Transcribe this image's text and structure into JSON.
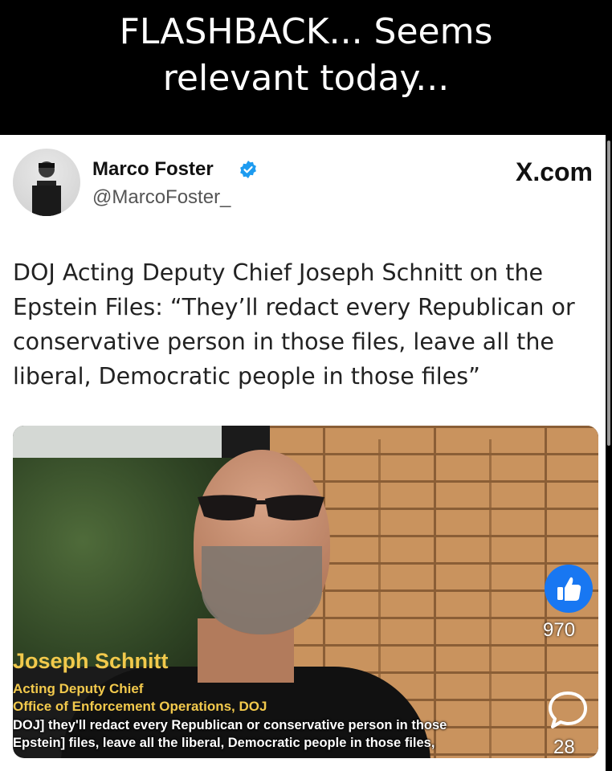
{
  "banner": {
    "line1": "FLASHBACK... Seems",
    "line2": "relevant today..."
  },
  "post": {
    "author_name": "Marco Foster",
    "author_handle": "@MarcoFoster_",
    "brand": "X.com",
    "text": "DOJ Acting Deputy Chief Joseph Schnitt on the Epstein Files: “They’ll redact every Republican or conservative person in those files, leave all the liberal, Democratic people in those files”"
  },
  "video": {
    "lower_third_name": "Joseph Schnitt",
    "lower_third_role": "Acting Deputy Chief",
    "lower_third_office": "Office of Enforcement Operations, DOJ",
    "caption_line1": "DOJ] they'll redact every Republican or conservative person in those",
    "caption_line2": "Epstein] files, leave all the liberal, Democratic people in those files,"
  },
  "reactions": {
    "like_count": "970",
    "comment_count": "28"
  },
  "icons": {
    "verified": "verified-badge-icon",
    "like": "thumbs-up-icon",
    "comment": "comment-bubble-icon"
  },
  "colors": {
    "like_blue": "#1877f2",
    "verified_blue": "#1d9bf0",
    "lower_third_yellow": "#f2c94c"
  }
}
